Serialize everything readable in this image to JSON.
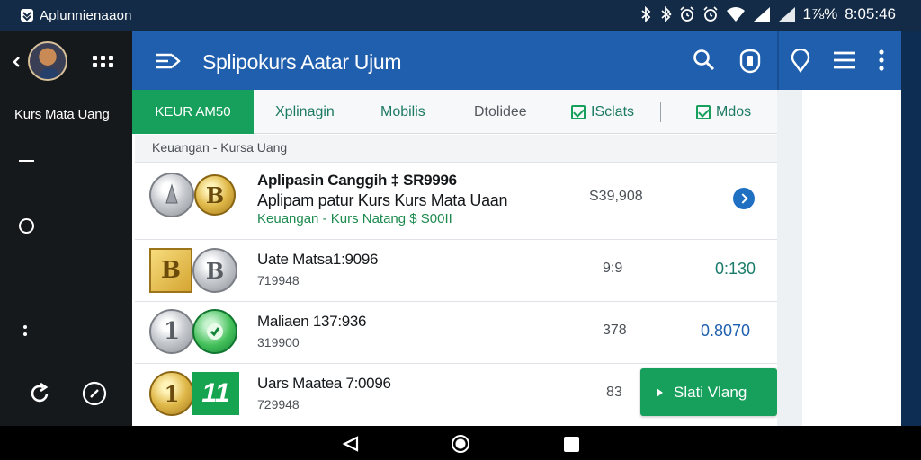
{
  "status_bar": {
    "app_title": "Aplunnienaaon",
    "battery": "1⅞%",
    "time": "8:05:46",
    "icons": [
      "bluetooth-icon",
      "bluetooth-alt-icon",
      "alarm-icon",
      "alarm-icon",
      "wifi-icon",
      "signal-icon",
      "signal-icon"
    ]
  },
  "left_panel": {
    "title": "Kurs Mata Uang",
    "icons": [
      "back-icon",
      "avatar",
      "grid-icon",
      "dash-icon",
      "circle-icon",
      "dots-icon",
      "refresh-icon",
      "compass-icon"
    ]
  },
  "app_bar": {
    "title": "Splipokurs Aatar Ujum",
    "icons": [
      "menu-arrow-icon",
      "search-icon",
      "shield-icon",
      "location-pin-icon",
      "hamburger-menu-icon",
      "more-vert-icon"
    ],
    "color": "#1f5fae"
  },
  "tabs": [
    {
      "label": "KEUR AM50",
      "active": true
    },
    {
      "label": "Xplinagin",
      "active": false
    },
    {
      "label": "Mobilis",
      "active": false
    },
    {
      "label": "Dtolidee",
      "active": false
    },
    {
      "label": "ISclats",
      "active": false,
      "checkbox": true
    },
    {
      "label": "Mdos",
      "active": false,
      "checkbox": true
    }
  ],
  "breadcrumb": "Keuangan - Kursa Uang",
  "rows": [
    {
      "title": "Aplipasin Canggih ‡ SR9996",
      "subtitle": "Aplipam patur Kurs Kurs Mata Uaan",
      "category": "Keuangan - Kurs Natang $ S00II",
      "amount": "S39,908",
      "coin_labels": [
        "",
        "B"
      ]
    },
    {
      "title": "Uate Matsa1:9096",
      "code": "719948",
      "amount": "9:9",
      "rate": "0:130",
      "coin_labels": [
        "B",
        "B"
      ]
    },
    {
      "title": "Maliaen 137:936",
      "code": "319900",
      "amount": "378",
      "rate": "0.8070",
      "coin_labels": [
        "1",
        ""
      ]
    },
    {
      "title": "Uars Maatea 7:0096",
      "code": "729948",
      "amount": "83",
      "coin_labels": [
        "1",
        "11"
      ]
    }
  ],
  "cta": {
    "label": "Slati Vlang",
    "color": "#17a05b"
  },
  "nav_bar": {
    "icons": [
      "nav-back-icon",
      "nav-home-icon",
      "nav-recents-icon"
    ]
  }
}
